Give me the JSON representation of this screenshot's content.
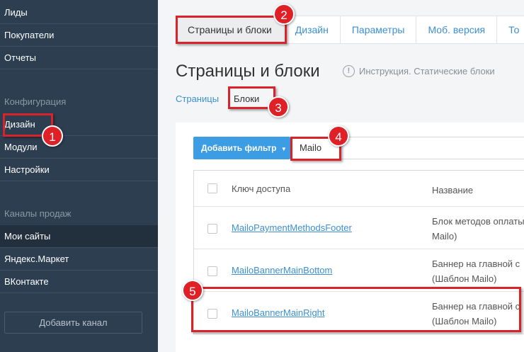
{
  "sidebar": {
    "items_top": [
      "Лиды",
      "Покупатели",
      "Отчеты"
    ],
    "section_config": "Конфигурация",
    "items_config": [
      "Дизайн",
      "Модули",
      "Настройки"
    ],
    "section_channels": "Каналы продаж",
    "items_channels": [
      "Мои сайты",
      "Яндекс.Маркет",
      "ВКонтакте"
    ],
    "add_channel": "Добавить канал"
  },
  "tabs": [
    "Страницы и блоки",
    "Дизайн",
    "Параметры",
    "Моб. версия",
    "То"
  ],
  "page_title": "Страницы и блоки",
  "help_text": "Инструкция. Статические блоки",
  "subtabs": {
    "pages": "Страницы",
    "blocks": "Блоки"
  },
  "filter": {
    "button_label": "Добавить фильтр",
    "input_value": "Mailo"
  },
  "table": {
    "headers": {
      "key": "Ключ доступа",
      "name": "Название"
    },
    "rows": [
      {
        "key": "MailoPaymentMethodsFooter",
        "name_line1": "Блок методов оплаты",
        "name_line2": "Mailo)"
      },
      {
        "key": "MailoBannerMainBottom",
        "name_line1": "Баннер на главной с",
        "name_line2": "(Шаблон Mailo)"
      },
      {
        "key": "MailoBannerMainRight",
        "name_line1": "Баннер на главной с",
        "name_line2": "(Шаблон Mailo)"
      }
    ]
  },
  "annotations": [
    "1",
    "2",
    "3",
    "4",
    "5"
  ],
  "colors": {
    "sidebar": "#2c3e50",
    "accent": "#3c9de4",
    "link": "#3c8fd3",
    "annotation": "#e02027"
  }
}
